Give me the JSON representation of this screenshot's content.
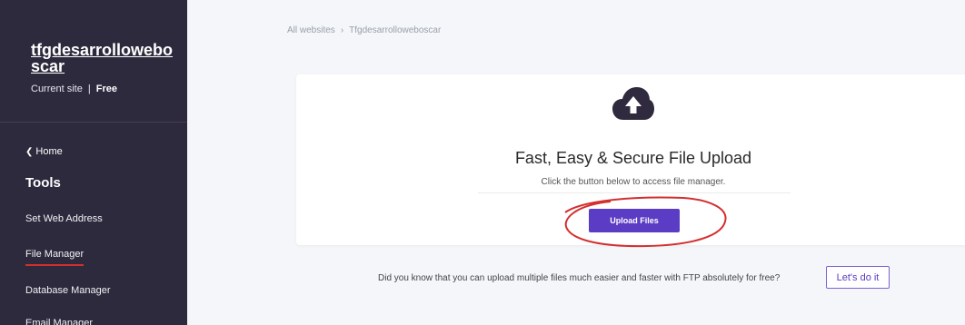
{
  "sidebar": {
    "site_name": "tfgdesarrollowebo scar",
    "current_site_label": "Current site",
    "separator": "|",
    "plan": "Free",
    "home_label": "Home",
    "tools_heading": "Tools",
    "items": [
      {
        "label": "Set Web Address"
      },
      {
        "label": "File Manager"
      },
      {
        "label": "Database Manager"
      },
      {
        "label": "Email Manager"
      }
    ]
  },
  "breadcrumb": {
    "root": "All websites",
    "arrow": "›",
    "current": "Tfgdesarrolloweboscar"
  },
  "card": {
    "icon": "cloud-upload-icon",
    "title": "Fast, Easy & Secure File Upload",
    "subtitle": "Click the button below to access file manager.",
    "button_label": "Upload Files"
  },
  "ftp": {
    "text": "Did you know that you can upload multiple files much easier and faster with FTP absolutely for free?",
    "button_label": "Let's do it"
  },
  "colors": {
    "sidebar_bg": "#2e2a3d",
    "accent": "#5b3cc4",
    "annotation": "#d32f2f"
  }
}
